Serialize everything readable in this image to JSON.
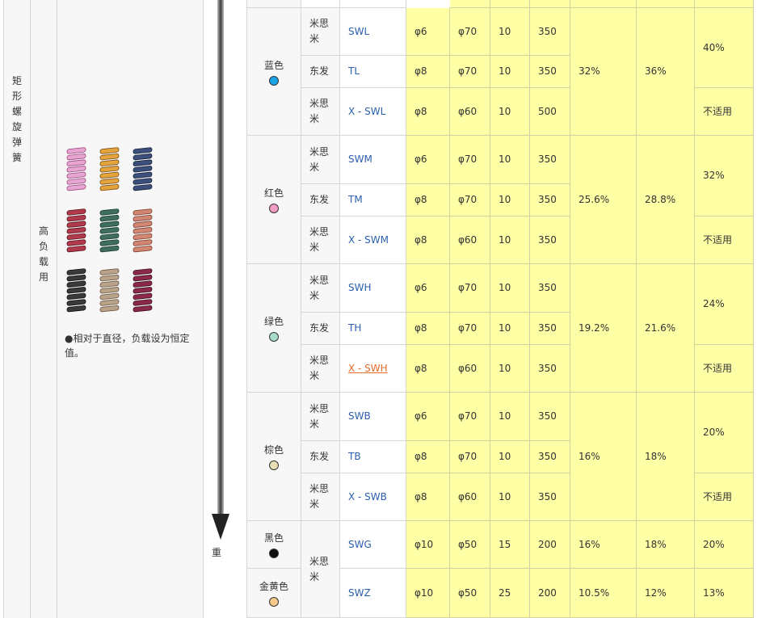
{
  "left": {
    "category": [
      "矩",
      "形",
      "螺",
      "旋",
      "弹",
      "簧"
    ],
    "usage": [
      "高",
      "负",
      "载",
      "用"
    ],
    "note": "●相对于直径，负载设为恒定值。",
    "springs": [
      {
        "name": "pink-spring-image",
        "color": "#e7a6d2",
        "stripe": "#a0427f"
      },
      {
        "name": "orange-spring-image",
        "color": "#e4a43b",
        "stripe": "#7a4a10"
      },
      {
        "name": "navy-spring-image",
        "color": "#3b4f7a",
        "stripe": "#1a2440"
      },
      {
        "name": "red-spring-image",
        "color": "#b0394a",
        "stripe": "#5a1420"
      },
      {
        "name": "green-spring-image",
        "color": "#3f6e5d",
        "stripe": "#183a2e"
      },
      {
        "name": "salmon-spring-image",
        "color": "#d08670",
        "stripe": "#7a3d2c"
      },
      {
        "name": "black-spring-image",
        "color": "#3a3a3a",
        "stripe": "#111111"
      },
      {
        "name": "tan-spring-image",
        "color": "#b8a28a",
        "stripe": "#6a5440"
      },
      {
        "name": "maroon-spring-image",
        "color": "#8a2a48",
        "stripe": "#3e0f20"
      }
    ],
    "heavy_label": "重"
  },
  "groups": [
    {
      "color_name": "蓝色",
      "dot": "#1aa3e6"
    },
    {
      "color_name": "红色",
      "dot": "#f19ec2"
    },
    {
      "color_name": "绿色",
      "dot": "#a9dcc8"
    },
    {
      "color_name": "棕色",
      "dot": "#e8ddb5"
    },
    {
      "color_name": "黑色",
      "dot": "#111111"
    },
    {
      "color_name": "金黄色",
      "dot": "#f5c98a"
    }
  ],
  "rows": [
    {
      "maker": "米思米",
      "model": "SWL",
      "d1": "φ6",
      "d2": "φ70",
      "v1": "10",
      "v2": "350"
    },
    {
      "maker": "东发",
      "model": "TL",
      "d1": "φ8",
      "d2": "φ70",
      "v1": "10",
      "v2": "350"
    },
    {
      "maker": "米思米",
      "model": "X - SWL",
      "d1": "φ8",
      "d2": "φ60",
      "v1": "10",
      "v2": "500"
    },
    {
      "maker": "米思米",
      "model": "SWM",
      "d1": "φ6",
      "d2": "φ70",
      "v1": "10",
      "v2": "350"
    },
    {
      "maker": "东发",
      "model": "TM",
      "d1": "φ8",
      "d2": "φ70",
      "v1": "10",
      "v2": "350"
    },
    {
      "maker": "米思米",
      "model": "X - SWM",
      "d1": "φ8",
      "d2": "φ60",
      "v1": "10",
      "v2": "350"
    },
    {
      "maker": "米思米",
      "model": "SWH",
      "d1": "φ6",
      "d2": "φ70",
      "v1": "10",
      "v2": "350"
    },
    {
      "maker": "东发",
      "model": "TH",
      "d1": "φ8",
      "d2": "φ70",
      "v1": "10",
      "v2": "350"
    },
    {
      "maker": "米思米",
      "model": "X - SWH",
      "d1": "φ8",
      "d2": "φ60",
      "v1": "10",
      "v2": "350"
    },
    {
      "maker": "米思米",
      "model": "SWB",
      "d1": "φ6",
      "d2": "φ70",
      "v1": "10",
      "v2": "350"
    },
    {
      "maker": "东发",
      "model": "TB",
      "d1": "φ8",
      "d2": "φ70",
      "v1": "10",
      "v2": "350"
    },
    {
      "maker": "米思米",
      "model": "X - SWB",
      "d1": "φ8",
      "d2": "φ60",
      "v1": "10",
      "v2": "350"
    },
    {
      "maker": "米思米",
      "model": "SWG",
      "d1": "φ10",
      "d2": "φ50",
      "v1": "15",
      "v2": "200"
    },
    {
      "maker": "",
      "model": "SWZ",
      "d1": "φ10",
      "d2": "φ50",
      "v1": "25",
      "v2": "200"
    }
  ],
  "rates": {
    "blue": {
      "p1": "32%",
      "p2": "36%",
      "p3a": "40%",
      "p3b": "不适用"
    },
    "red": {
      "p1": "25.6%",
      "p2": "28.8%",
      "p3a": "32%",
      "p3b": "不适用"
    },
    "green": {
      "p1": "19.2%",
      "p2": "21.6%",
      "p3a": "24%",
      "p3b": "不适用"
    },
    "brown": {
      "p1": "16%",
      "p2": "18%",
      "p3a": "20%",
      "p3b": "不适用"
    },
    "black": {
      "p1": "16%",
      "p2": "18%",
      "p3": "20%"
    },
    "gold": {
      "p1": "10.5%",
      "p2": "12%",
      "p3": "13%"
    },
    "shared_maker": "米思米"
  }
}
